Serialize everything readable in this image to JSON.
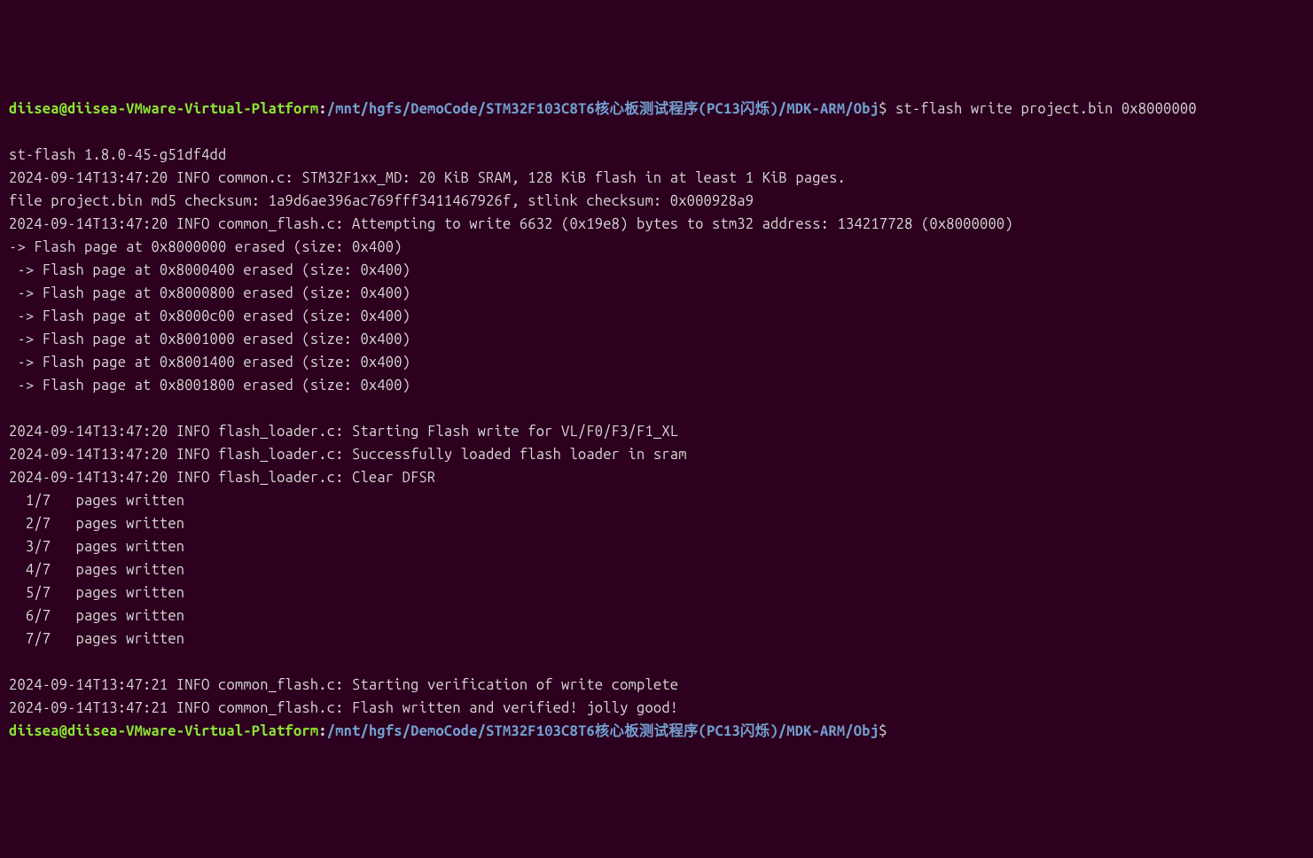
{
  "prompt1": {
    "user": "diisea",
    "at": "@",
    "host": "diisea-VMware-Virtual-Platform",
    "colon": ":",
    "path": "/mnt/hgfs/DemoCode/STM32F103C8T6核心板测试程序(PC13闪烁)/MDK-ARM/Obj",
    "dollar": "$",
    "command": " st-flash write project.bin 0x8000000"
  },
  "output_before_blank": [
    "st-flash 1.8.0-45-g51df4dd",
    "2024-09-14T13:47:20 INFO common.c: STM32F1xx_MD: 20 KiB SRAM, 128 KiB flash in at least 1 KiB pages.",
    "file project.bin md5 checksum: 1a9d6ae396ac769fff3411467926f, stlink checksum: 0x000928a9",
    "2024-09-14T13:47:20 INFO common_flash.c: Attempting to write 6632 (0x19e8) bytes to stm32 address: 134217728 (0x8000000)",
    "-> Flash page at 0x8000000 erased (size: 0x400)",
    " -> Flash page at 0x8000400 erased (size: 0x400)",
    " -> Flash page at 0x8000800 erased (size: 0x400)",
    " -> Flash page at 0x8000c00 erased (size: 0x400)",
    " -> Flash page at 0x8001000 erased (size: 0x400)",
    " -> Flash page at 0x8001400 erased (size: 0x400)",
    " -> Flash page at 0x8001800 erased (size: 0x400)"
  ],
  "output_after_blank": [
    "2024-09-14T13:47:20 INFO flash_loader.c: Starting Flash write for VL/F0/F3/F1_XL",
    "2024-09-14T13:47:20 INFO flash_loader.c: Successfully loaded flash loader in sram",
    "2024-09-14T13:47:20 INFO flash_loader.c: Clear DFSR",
    "  1/7   pages written",
    "  2/7   pages written",
    "  3/7   pages written",
    "  4/7   pages written",
    "  5/7   pages written",
    "  6/7   pages written",
    "  7/7   pages written"
  ],
  "output_final": [
    "2024-09-14T13:47:21 INFO common_flash.c: Starting verification of write complete",
    "2024-09-14T13:47:21 INFO common_flash.c: Flash written and verified! jolly good!"
  ],
  "prompt2": {
    "user": "diisea",
    "at": "@",
    "host": "diisea-VMware-Virtual-Platform",
    "colon": ":",
    "path": "/mnt/hgfs/DemoCode/STM32F103C8T6核心板测试程序(PC13闪烁)/MDK-ARM/Obj",
    "dollar": "$",
    "command": ""
  }
}
